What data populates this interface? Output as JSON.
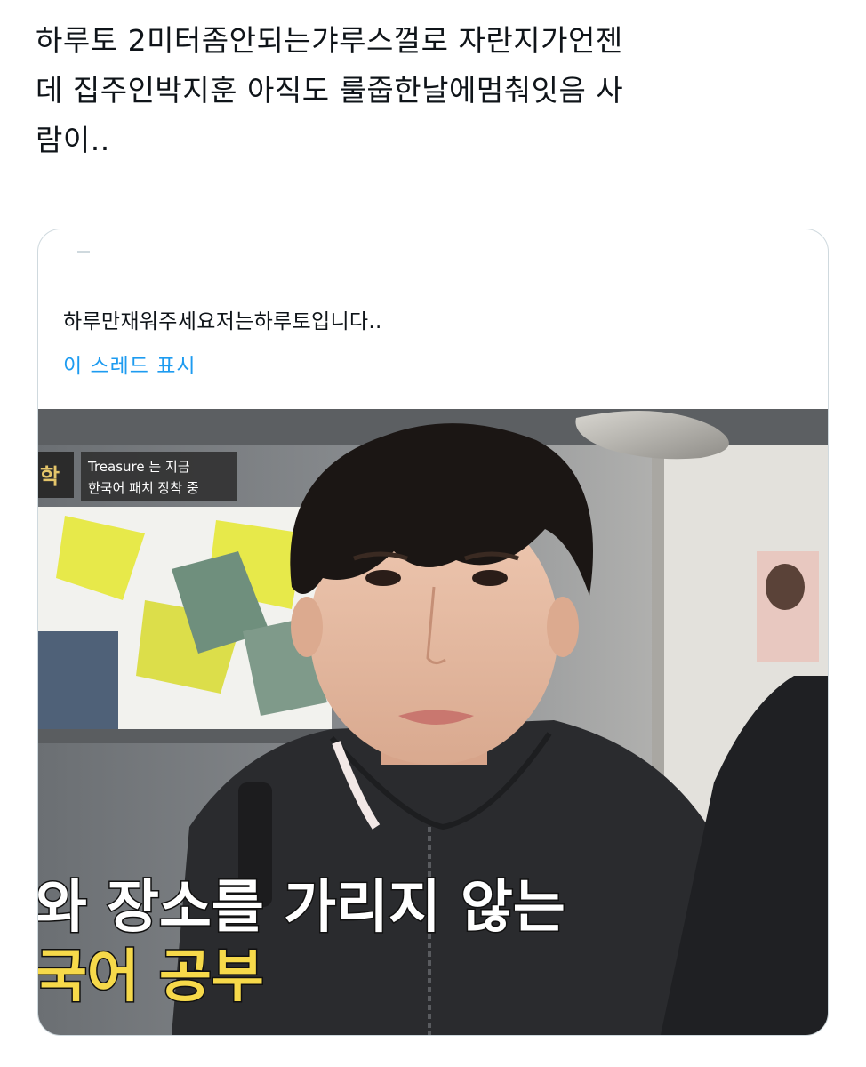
{
  "tweet": {
    "text_line1": "하루토 2미터좀안되는갸루스껄로 자란지가언젠",
    "text_line2": "데 집주인박지훈 아직도 룰줍한날에멈춰잇음 사",
    "text_line3": "람이.."
  },
  "quoted_tweet": {
    "text": "하루만재워주세요저는하루토입니다..",
    "show_thread_label": "이 스레드 표시"
  },
  "photo": {
    "overlay_top_line1": "Treasure 는 지금",
    "overlay_top_line2": "한국어 패치 장착 중",
    "logo_fragment": "학",
    "subtitle_line1": "와 장소를 가리지 않는",
    "subtitle_line2": "국어 공부",
    "colors": {
      "subtitle_white": "#ffffff",
      "subtitle_highlight": "#f6d94a",
      "poster_yellow": "#e7e94a",
      "hoodie": "#2a2b2e"
    }
  }
}
